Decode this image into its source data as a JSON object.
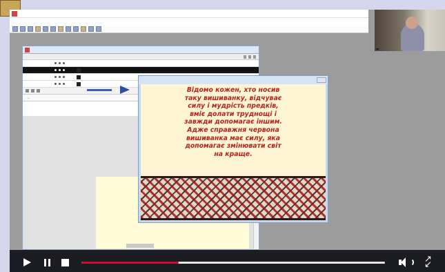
{
  "slide": {
    "text": "Відомо кожен, хто носив\nтаку вишиванку, відчуває\nсилу і мудрість предків,\nвміє долати труднощі і\nзавжди допомагає іншим.\nАдже справжня червона\nвишиванка має силу, яка\nдопомагає змінювати світ\nна краще."
  },
  "player": {
    "progress_percent": 32
  },
  "colors": {
    "slide_text": "#b6231f",
    "slide_bg": "#fdf5d3",
    "progress": "#c8102e",
    "player_bg": "#1c1d22",
    "desktop_bg": "#9c9c9c"
  }
}
